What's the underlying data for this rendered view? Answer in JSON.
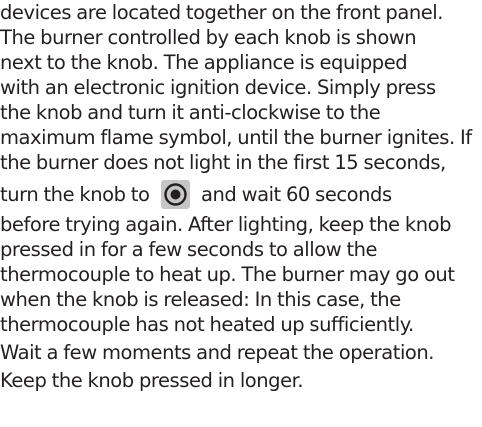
{
  "document": {
    "lines": [
      "devices are located together on the front panel.",
      "The burner controlled by each knob is shown",
      "next to the knob. The appliance is equipped",
      "with an electronic ignition device. Simply press",
      "the knob and turn it anti-clockwise to the",
      "maximum flame symbol, until the burner ignites. If",
      "the burner does not light in the first 15 seconds,",
      "before trying again. After lighting, keep the knob",
      "pressed in for a few seconds to allow the",
      "thermocouple to heat up. The burner may go out",
      "when the knob is released: In this case, the",
      "thermocouple has not heated up sufficiently.",
      "Wait a few moments and repeat the operation.",
      "Keep the knob pressed in longer."
    ],
    "icon_line": {
      "before": "turn the knob to",
      "after": "and wait 60 seconds",
      "icon": "knob-off-position-icon",
      "icon_background": "#c6c6c6"
    },
    "text_color": "#231f20"
  }
}
